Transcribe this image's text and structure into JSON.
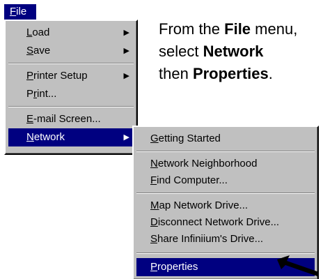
{
  "menubar": {
    "title_prefix": "",
    "title_accel": "F",
    "title_rest": "ile"
  },
  "file_menu": {
    "items": [
      {
        "accel": "L",
        "rest": "oad",
        "pre": "",
        "arrow": "▶"
      },
      {
        "accel": "S",
        "rest": "ave",
        "pre": "",
        "arrow": "▶"
      },
      {
        "pre": "",
        "accel": "P",
        "rest": "rinter Setup",
        "arrow": "▶"
      },
      {
        "pre": "P",
        "accel": "r",
        "rest": "int...",
        "arrow": ""
      },
      {
        "pre": "",
        "accel": "E",
        "rest": "-mail Screen...",
        "arrow": ""
      },
      {
        "pre": "",
        "accel": "N",
        "rest": "etwork",
        "arrow": "▶"
      }
    ]
  },
  "network_menu": {
    "items": [
      {
        "pre": "",
        "accel": "G",
        "rest": "etting Started"
      },
      {
        "pre": "",
        "accel": "N",
        "rest": "etwork Neighborhood"
      },
      {
        "pre": "",
        "accel": "F",
        "rest": "ind Computer..."
      },
      {
        "pre": "",
        "accel": "M",
        "rest": "ap Network Drive..."
      },
      {
        "pre": "",
        "accel": "D",
        "rest": "isconnect Network Drive..."
      },
      {
        "pre": "",
        "accel": "S",
        "rest": "hare Infiniium's Drive..."
      },
      {
        "pre": "",
        "accel": "P",
        "rest": "roperties"
      }
    ]
  },
  "caption": {
    "line1_a": "From the ",
    "line1_b": "File",
    "line1_c": " menu,",
    "line2_a": "select ",
    "line2_b": "Network",
    "line3_a": "then ",
    "line3_b": "Properties",
    "line3_c": "."
  }
}
